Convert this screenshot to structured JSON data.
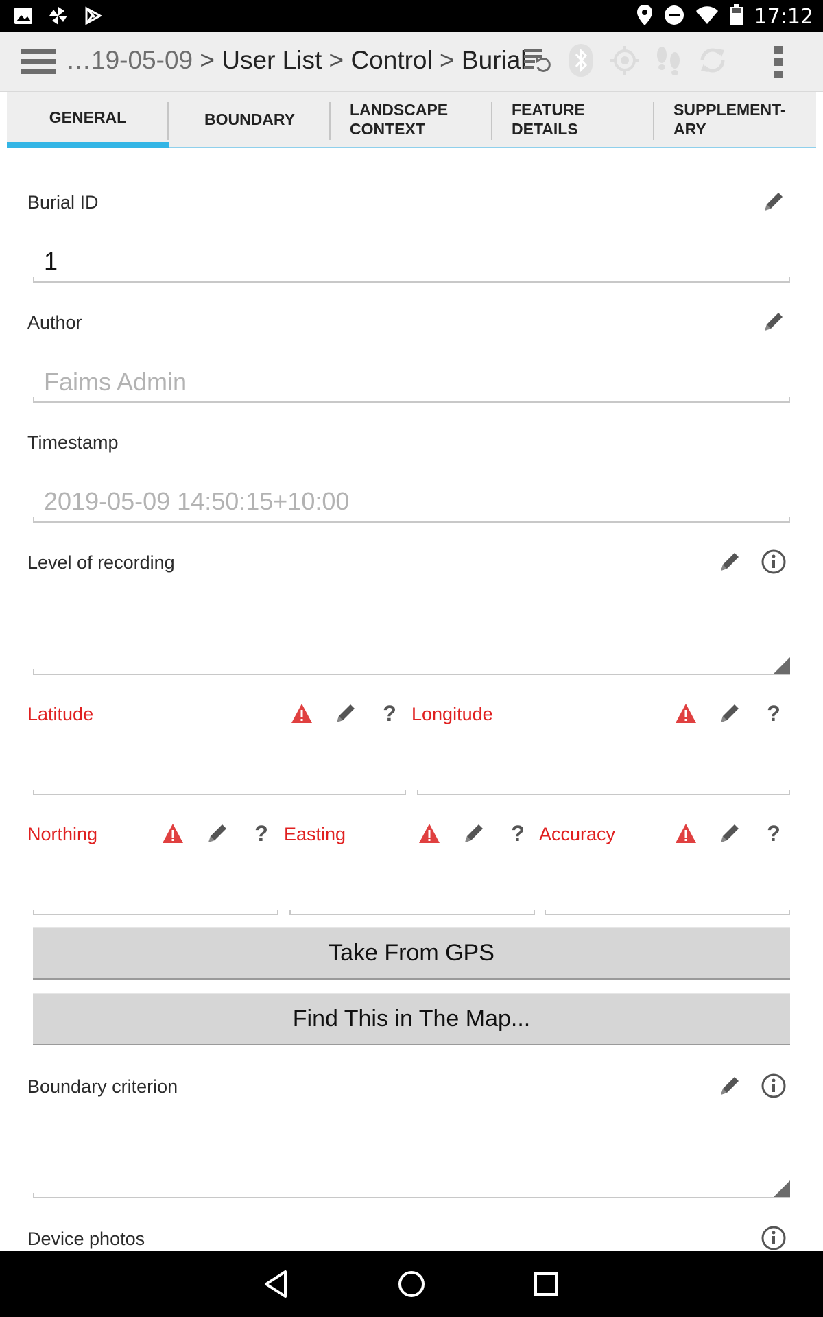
{
  "status_bar": {
    "time": "17:12",
    "left_icons": [
      "image-icon",
      "pinwheel-icon",
      "play-store-icon"
    ],
    "right_icons": [
      "location-icon",
      "do-not-disturb-icon",
      "wifi-icon",
      "battery-icon"
    ]
  },
  "action_bar": {
    "breadcrumb": {
      "truncated": "…19-05-09",
      "separator": ">",
      "items": [
        "User List",
        "Control",
        "Burial"
      ]
    },
    "icons": [
      "sync-list-icon",
      "bluetooth-icon",
      "gps-target-icon",
      "tracking-footsteps-icon",
      "sync-icon",
      "overflow-menu-icon"
    ]
  },
  "tabs": [
    {
      "label": "GENERAL",
      "active": true
    },
    {
      "label": "BOUNDARY",
      "active": false
    },
    {
      "label": "LANDSCAPE CONTEXT",
      "active": false
    },
    {
      "label": "FEATURE DETAILS",
      "active": false
    },
    {
      "label": "SUPPLEMENT-ARY",
      "active": false
    }
  ],
  "form": {
    "burial_id": {
      "label": "Burial ID",
      "value": "1"
    },
    "author": {
      "label": "Author",
      "value": "Faims Admin"
    },
    "timestamp": {
      "label": "Timestamp",
      "value": "2019-05-09 14:50:15+10:00"
    },
    "level_of_recording": {
      "label": "Level of recording",
      "value": ""
    },
    "latitude": {
      "label": "Latitude",
      "value": ""
    },
    "longitude": {
      "label": "Longitude",
      "value": ""
    },
    "northing": {
      "label": "Northing",
      "value": ""
    },
    "easting": {
      "label": "Easting",
      "value": ""
    },
    "accuracy": {
      "label": "Accuracy",
      "value": ""
    },
    "take_from_gps": "Take From GPS",
    "find_in_map": "Find This in The Map...",
    "boundary_criterion": {
      "label": "Boundary criterion",
      "value": ""
    },
    "device_photos": {
      "label": "Device photos"
    },
    "help_mark": "?"
  },
  "colors": {
    "tab_indicator": "#33b5e5",
    "required_label": "#e02020",
    "warning_icon": "#e04040"
  }
}
